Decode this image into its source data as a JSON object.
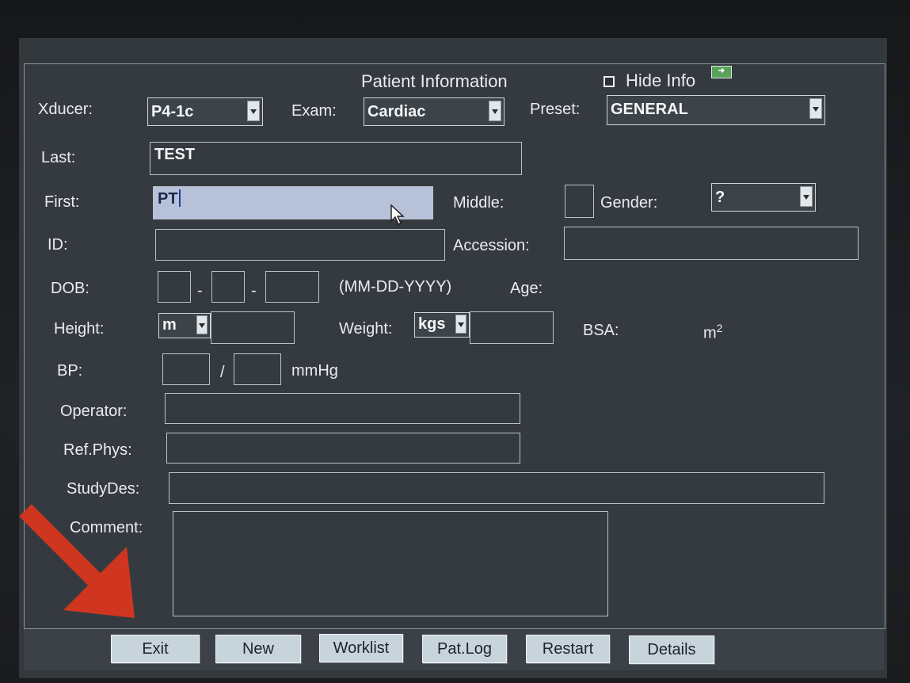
{
  "panel": {
    "title": "Patient Information",
    "hide_info_label": "Hide Info",
    "hide_info_checked": true,
    "hide_info_icon": "green-arrow-icon"
  },
  "top_row": {
    "xducer_label": "Xducer:",
    "xducer_value": "P4-1c",
    "exam_label": "Exam:",
    "exam_value": "Cardiac",
    "preset_label": "Preset:",
    "preset_value": "GENERAL"
  },
  "fields": {
    "last_label": "Last:",
    "last_value": "TEST",
    "first_label": "First:",
    "first_value": "PT",
    "middle_label": "Middle:",
    "middle_value": "",
    "gender_label": "Gender:",
    "gender_value": "?",
    "id_label": "ID:",
    "id_value": "",
    "accession_label": "Accession:",
    "accession_value": "",
    "dob_label": "DOB:",
    "dob_sep": "-",
    "dob_format": "(MM-DD-YYYY)",
    "age_label": "Age:",
    "height_label": "Height:",
    "height_unit": "m",
    "weight_label": "Weight:",
    "weight_unit": "kgs",
    "bsa_label": "BSA:",
    "bsa_unit": "m",
    "bsa_unit_exp": "2",
    "bp_label": "BP:",
    "bp_sep": "/",
    "bp_unit": "mmHg",
    "operator_label": "Operator:",
    "refphys_label": "Ref.Phys:",
    "studydes_label": "StudyDes:",
    "comment_label": "Comment:"
  },
  "buttons": {
    "exit": "Exit",
    "new": "New",
    "worklist": "Worklist",
    "patlog": "Pat.Log",
    "restart": "Restart",
    "details": "Details"
  },
  "colors": {
    "panel_bg": "#343a40",
    "focused_field": "#b7c2d9",
    "button_bg": "#c8d4dc",
    "annotation_arrow": "#d0361f"
  }
}
